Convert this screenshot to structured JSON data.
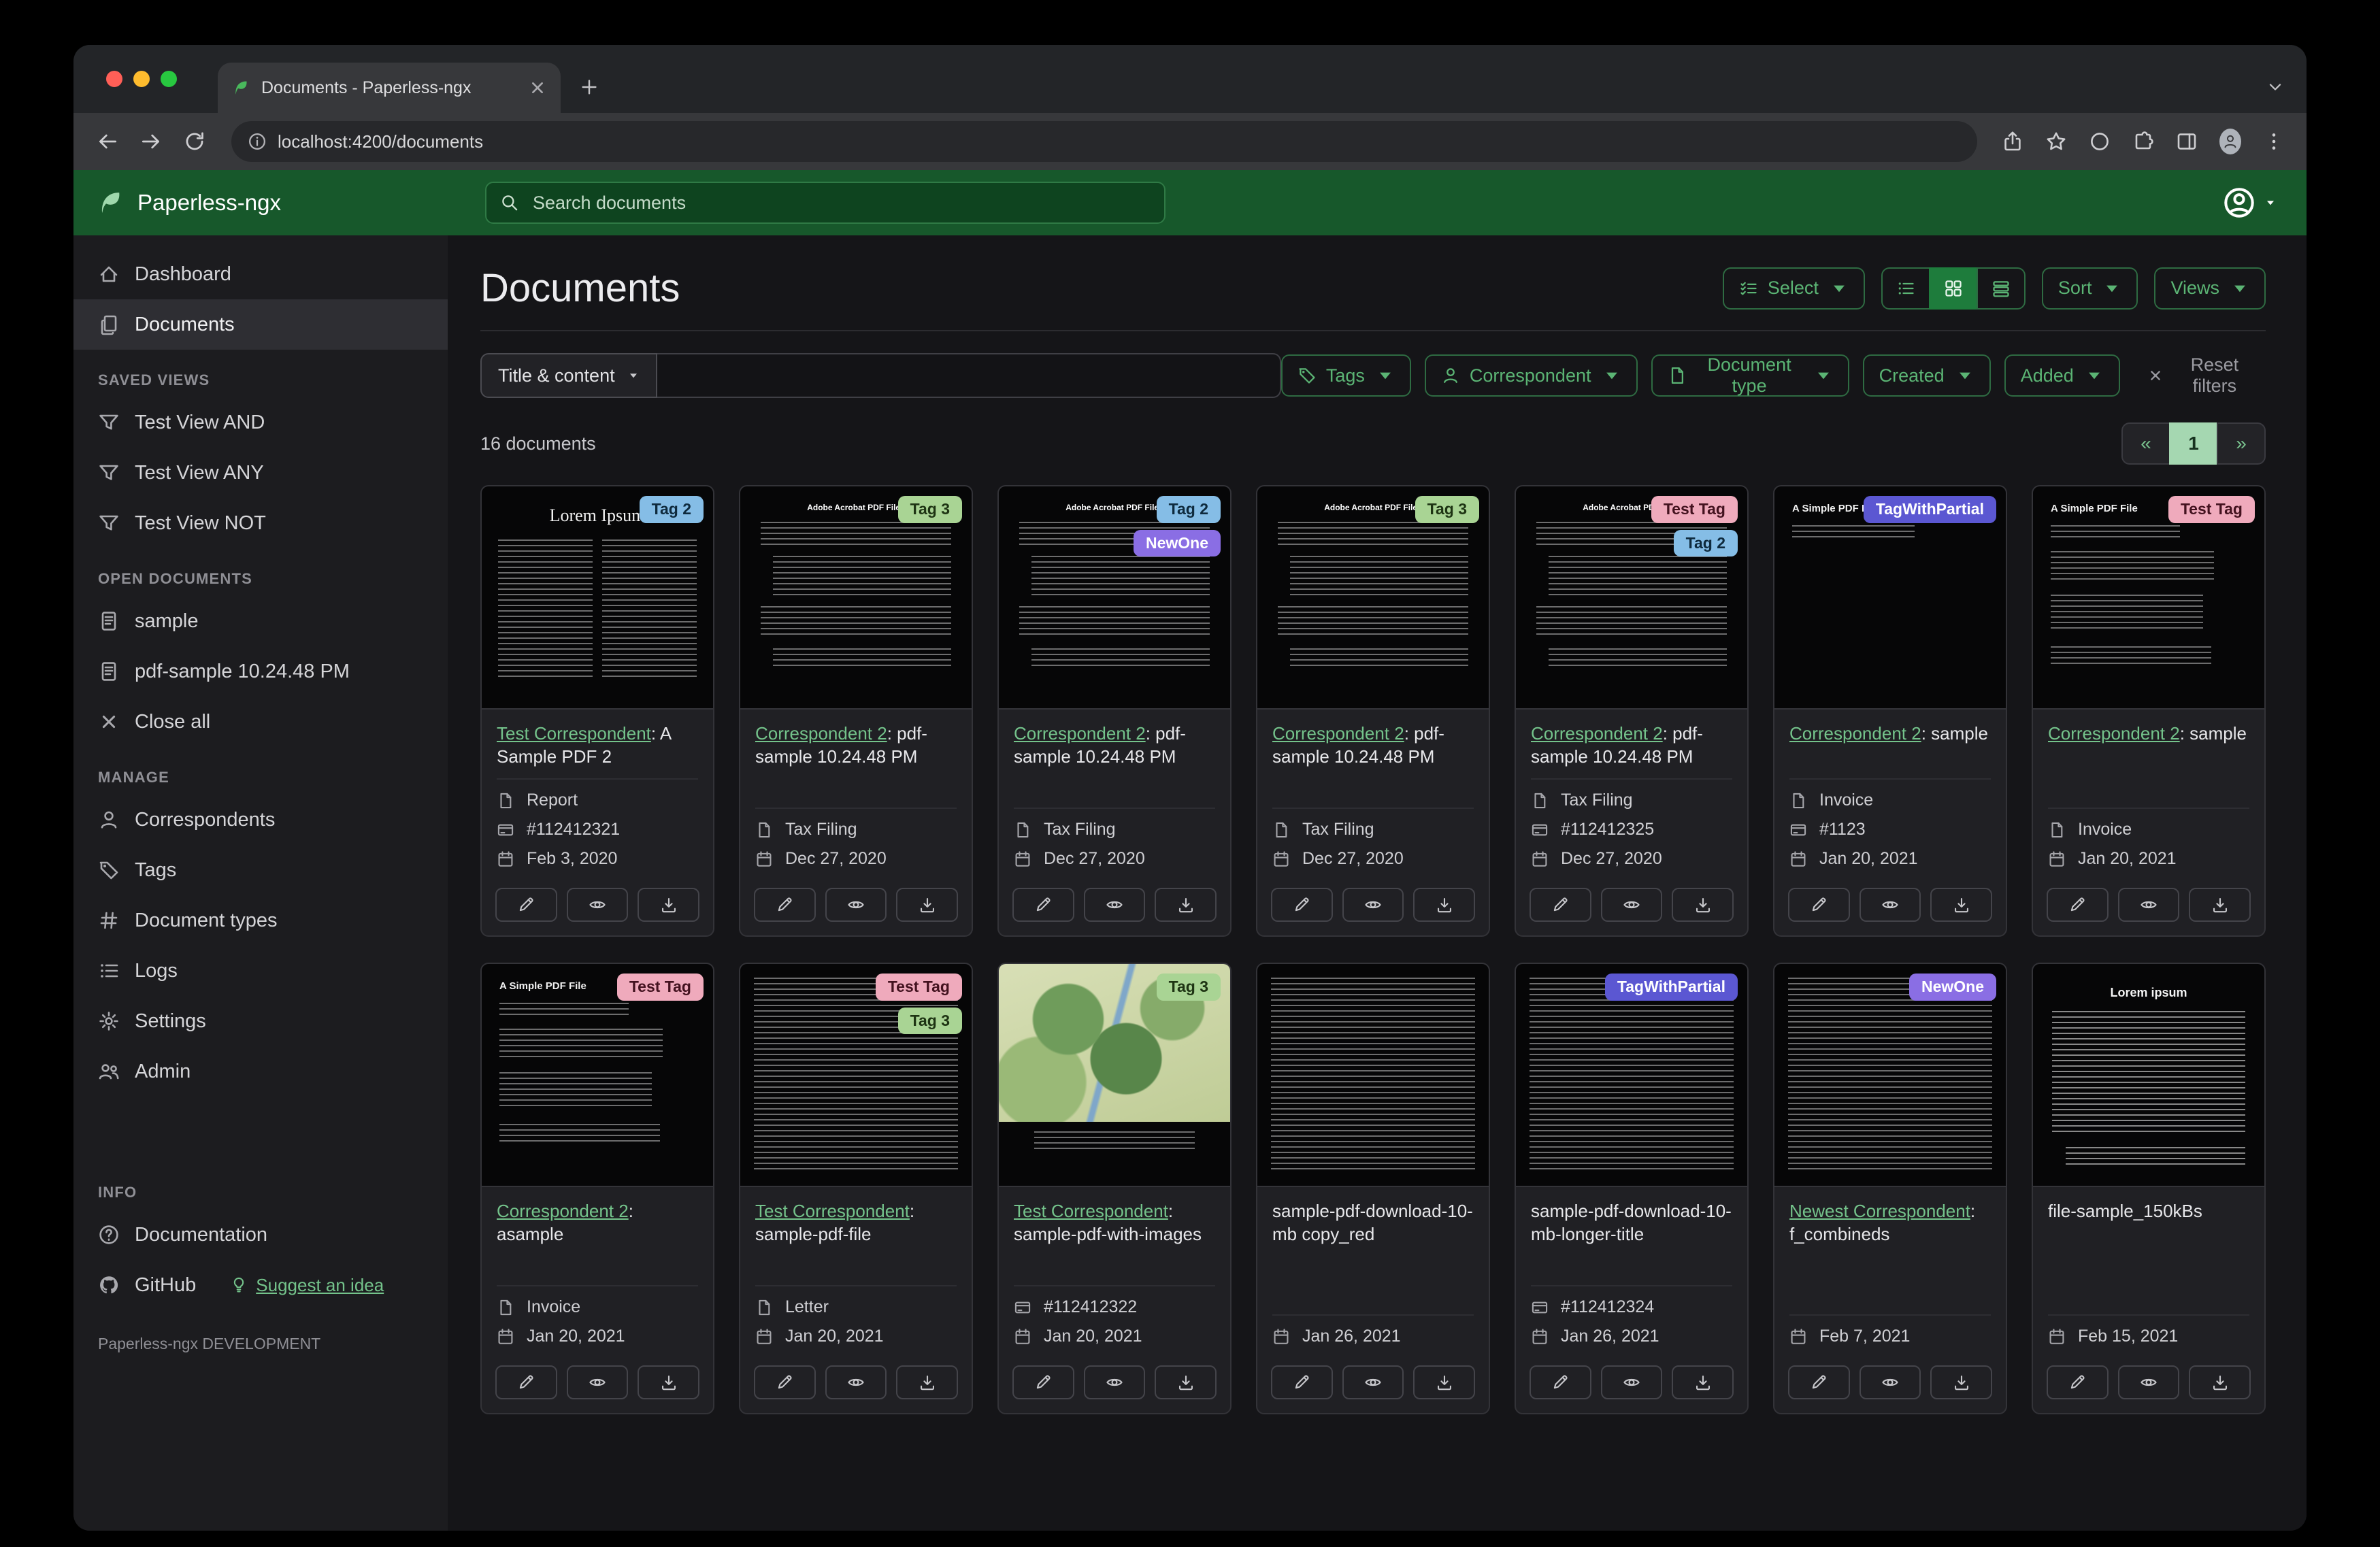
{
  "colors": {
    "navbar_green": "#17582b",
    "accent_green": "#5bb474",
    "link_green": "#74c38b",
    "pagination_active": "#a5d7b1"
  },
  "browser": {
    "tab_title": "Documents - Paperless-ngx",
    "url": "localhost:4200/documents"
  },
  "header": {
    "app_name": "Paperless-ngx",
    "search_placeholder": "Search documents"
  },
  "sidebar": {
    "nav": [
      "Dashboard",
      "Documents"
    ],
    "sections": {
      "saved": {
        "title": "SAVED VIEWS",
        "items": [
          "Test View AND",
          "Test View ANY",
          "Test View NOT"
        ]
      },
      "open": {
        "title": "OPEN DOCUMENTS",
        "docs": [
          "sample",
          "pdf-sample 10.24.48 PM"
        ],
        "close_label": "Close all"
      },
      "manage": {
        "title": "MANAGE",
        "items": [
          "Correspondents",
          "Tags",
          "Document types",
          "Logs",
          "Settings",
          "Admin"
        ]
      },
      "info": {
        "title": "INFO",
        "documentation": "Documentation",
        "github": "GitHub",
        "suggest": "Suggest an idea"
      }
    },
    "footer": "Paperless-ngx DEVELOPMENT"
  },
  "main": {
    "title": "Documents",
    "select_label": "Select",
    "sort_label": "Sort",
    "views_label": "Views",
    "filters": {
      "field_label": "Title & content",
      "tags": "Tags",
      "correspondent": "Correspondent",
      "document_type": "Document type",
      "created": "Created",
      "added": "Added",
      "reset": "Reset filters"
    },
    "count": "16 documents",
    "pagination": {
      "prev": "«",
      "page": "1",
      "next": "»"
    }
  },
  "cards": [
    {
      "thumb": "lorem",
      "thumb_text": "Lorem Ipsum",
      "correspondent": "Test Correspondent",
      "title": ": A Sample PDF 2",
      "tags": [
        {
          "label": "Tag 2",
          "bg": "#85bde6",
          "fg": "#0e2a3d"
        }
      ],
      "meta": [
        {
          "icon": "type",
          "text": "Report"
        },
        {
          "icon": "asn",
          "text": "#112412321"
        },
        {
          "icon": "date",
          "text": "Feb 3, 2020"
        }
      ]
    },
    {
      "thumb": "acrobat",
      "thumb_text": "Adobe Acrobat PDF Files",
      "correspondent": "Correspondent 2",
      "title": ": pdf-sample 10.24.48 PM",
      "tags": [
        {
          "label": "Tag 3",
          "bg": "#a9d494",
          "fg": "#1e3413"
        }
      ],
      "meta": [
        {
          "icon": "type",
          "text": "Tax Filing"
        },
        {
          "icon": "date",
          "text": "Dec 27, 2020"
        }
      ]
    },
    {
      "thumb": "acrobat",
      "thumb_text": "Adobe Acrobat PDF Files",
      "correspondent": "Correspondent 2",
      "title": ": pdf-sample 10.24.48 PM",
      "tags": [
        {
          "label": "Tag 2",
          "bg": "#85bde6",
          "fg": "#0e2a3d"
        },
        {
          "label": "NewOne",
          "bg": "#8a6ee4",
          "fg": "#ffffff"
        }
      ],
      "meta": [
        {
          "icon": "type",
          "text": "Tax Filing"
        },
        {
          "icon": "date",
          "text": "Dec 27, 2020"
        }
      ]
    },
    {
      "thumb": "acrobat",
      "thumb_text": "Adobe Acrobat PDF Files",
      "correspondent": "Correspondent 2",
      "title": ": pdf-sample 10.24.48 PM",
      "tags": [
        {
          "label": "Tag 3",
          "bg": "#a9d494",
          "fg": "#1e3413"
        }
      ],
      "meta": [
        {
          "icon": "type",
          "text": "Tax Filing"
        },
        {
          "icon": "date",
          "text": "Dec 27, 2020"
        }
      ]
    },
    {
      "thumb": "acrobat",
      "thumb_text": "Adobe Acrobat PDF Files",
      "correspondent": "Correspondent 2",
      "title": ": pdf-sample 10.24.48 PM",
      "tags": [
        {
          "label": "Test Tag",
          "bg": "#efaabc",
          "fg": "#43121f"
        },
        {
          "label": "Tag 2",
          "bg": "#85bde6",
          "fg": "#0e2a3d"
        }
      ],
      "meta": [
        {
          "icon": "type",
          "text": "Tax Filing"
        },
        {
          "icon": "asn",
          "text": "#112412325"
        },
        {
          "icon": "date",
          "text": "Dec 27, 2020"
        }
      ]
    },
    {
      "thumb": "simple-min",
      "thumb_text": "A Simple PDF File",
      "correspondent": "Correspondent 2",
      "title": ": sample",
      "tags": [
        {
          "label": "TagWithPartial",
          "bg": "#5b57d2",
          "fg": "#ffffff"
        }
      ],
      "meta": [
        {
          "icon": "type",
          "text": "Invoice"
        },
        {
          "icon": "asn",
          "text": "#1123"
        },
        {
          "icon": "date",
          "text": "Jan 20, 2021"
        }
      ]
    },
    {
      "thumb": "simple",
      "thumb_text": "A Simple PDF File",
      "correspondent": "Correspondent 2",
      "title": ": sample",
      "tags": [
        {
          "label": "Test Tag",
          "bg": "#efaabc",
          "fg": "#43121f"
        }
      ],
      "meta": [
        {
          "icon": "type",
          "text": "Invoice"
        },
        {
          "icon": "date",
          "text": "Jan 20, 2021"
        }
      ]
    },
    {
      "thumb": "simple",
      "thumb_text": "A Simple PDF File",
      "correspondent": "Correspondent 2",
      "title": ": asample",
      "tags": [
        {
          "label": "Test Tag",
          "bg": "#efaabc",
          "fg": "#43121f"
        }
      ],
      "meta": [
        {
          "icon": "type",
          "text": "Invoice"
        },
        {
          "icon": "date",
          "text": "Jan 20, 2021"
        }
      ]
    },
    {
      "thumb": "dense",
      "correspondent": "Test Correspondent",
      "title": ": sample-pdf-file",
      "tags": [
        {
          "label": "Test Tag",
          "bg": "#efaabc",
          "fg": "#43121f"
        },
        {
          "label": "Tag 3",
          "bg": "#a9d494",
          "fg": "#1e3413"
        }
      ],
      "meta": [
        {
          "icon": "type",
          "text": "Letter"
        },
        {
          "icon": "date",
          "text": "Jan 20, 2021"
        }
      ]
    },
    {
      "thumb": "map",
      "correspondent": "Test Correspondent",
      "title": ": sample-pdf-with-images",
      "tags": [
        {
          "label": "Tag 3",
          "bg": "#a9d494",
          "fg": "#1e3413"
        }
      ],
      "meta": [
        {
          "icon": "asn",
          "text": "#112412322"
        },
        {
          "icon": "date",
          "text": "Jan 20, 2021"
        }
      ]
    },
    {
      "thumb": "dense",
      "correspondent": null,
      "title": "sample-pdf-download-10-mb copy_red",
      "tags": [],
      "meta": [
        {
          "icon": "date",
          "text": "Jan 26, 2021"
        }
      ]
    },
    {
      "thumb": "dense",
      "correspondent": null,
      "title": "sample-pdf-download-10-mb-longer-title",
      "tags": [
        {
          "label": "TagWithPartial",
          "bg": "#5b57d2",
          "fg": "#ffffff"
        }
      ],
      "meta": [
        {
          "icon": "asn",
          "text": "#112412324"
        },
        {
          "icon": "date",
          "text": "Jan 26, 2021"
        }
      ]
    },
    {
      "thumb": "dense",
      "correspondent": "Newest Correspondent",
      "title": ": f_combineds",
      "tags": [
        {
          "label": "NewOne",
          "bg": "#8a6ee4",
          "fg": "#ffffff"
        }
      ],
      "meta": [
        {
          "icon": "date",
          "text": "Feb 7, 2021"
        }
      ]
    },
    {
      "thumb": "lorem-center",
      "thumb_text": "Lorem ipsum",
      "correspondent": null,
      "title": "file-sample_150kBs",
      "tags": [],
      "meta": [
        {
          "icon": "date",
          "text": "Feb 15, 2021"
        }
      ]
    }
  ]
}
